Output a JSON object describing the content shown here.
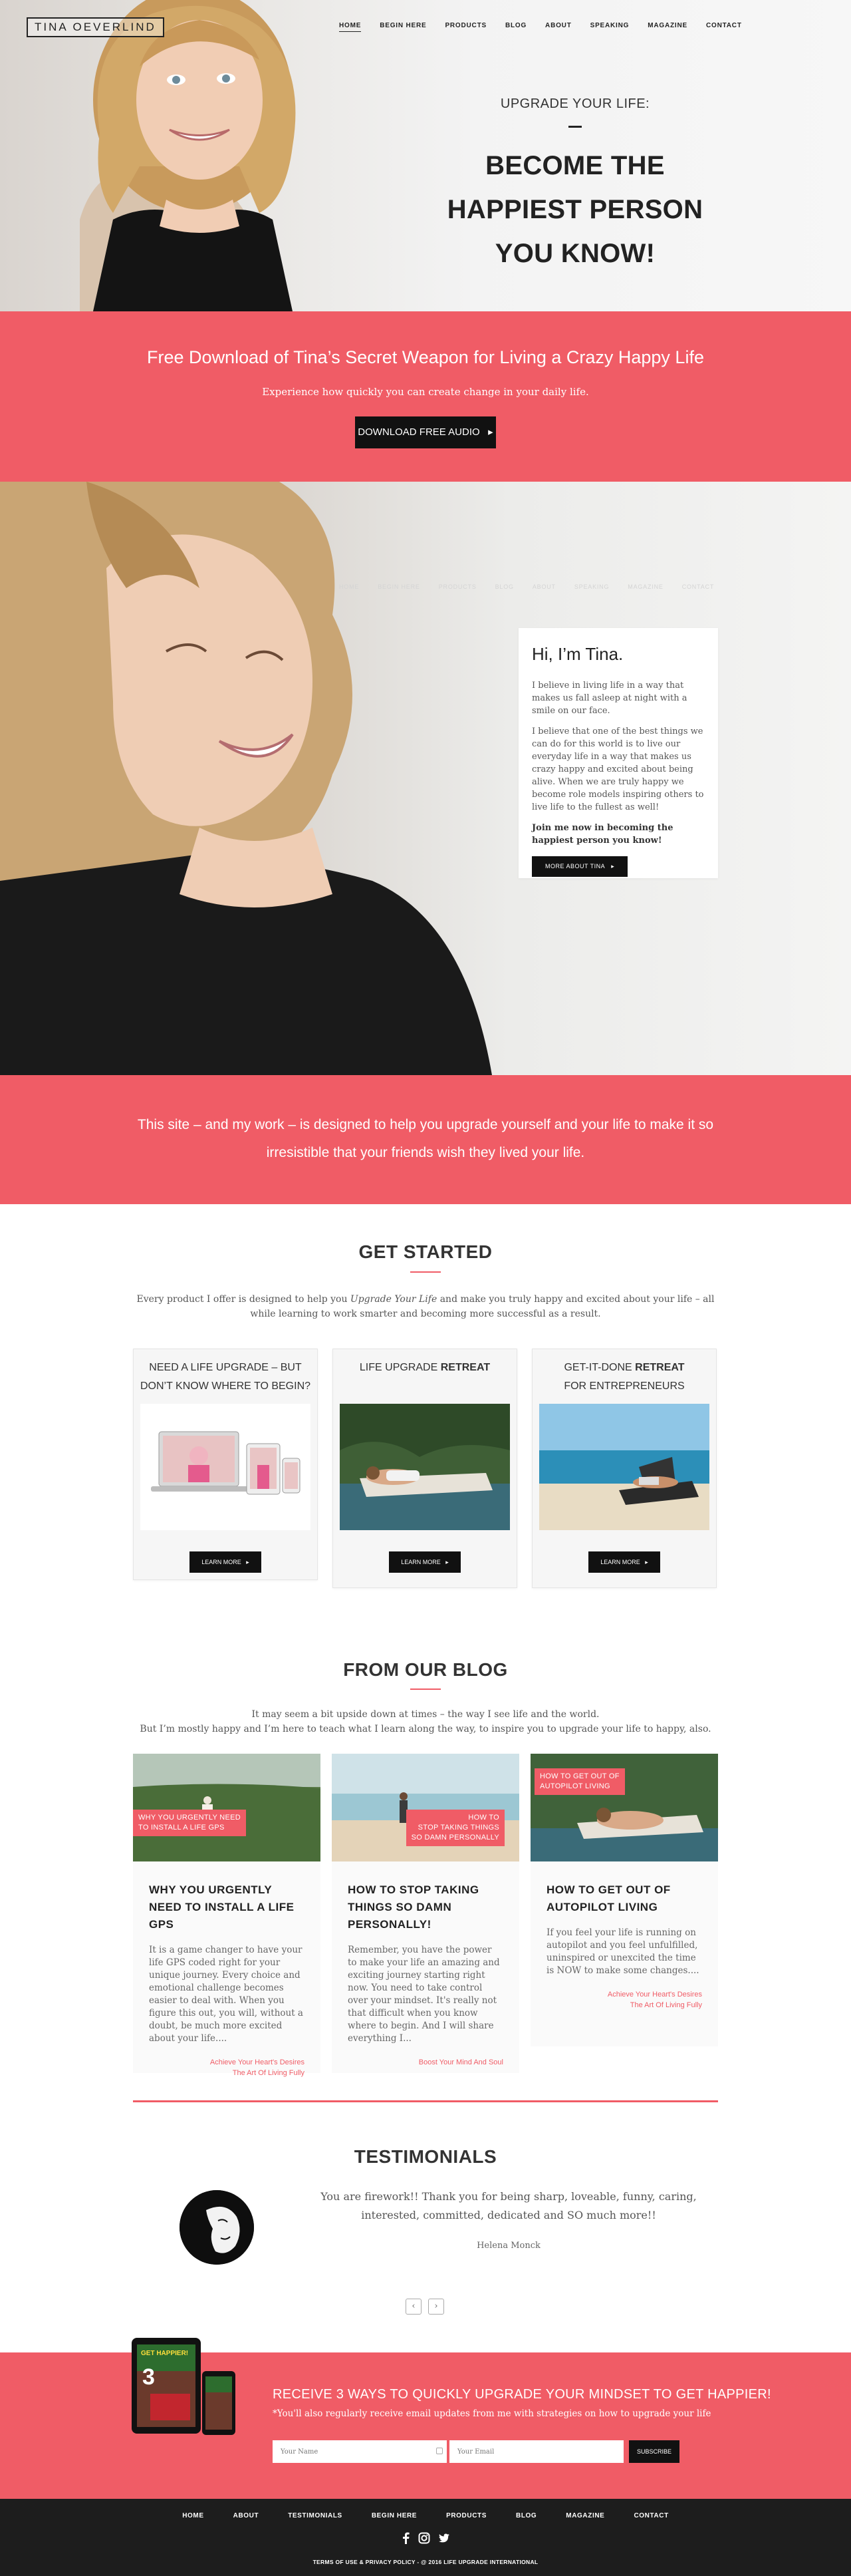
{
  "header": {
    "logo": "TINA OEVERLIND",
    "nav": [
      "HOME",
      "BEGIN HERE",
      "PRODUCTS",
      "BLOG",
      "ABOUT",
      "SPEAKING",
      "MAGAZINE",
      "CONTACT"
    ],
    "active": "HOME"
  },
  "hero": {
    "kicker": "UPGRADE YOUR LIFE:",
    "title": "BECOME THE HAPPIEST PERSON YOU KNOW!"
  },
  "download": {
    "title": "Free Download of Tina’s Secret Weapon for Living a Crazy Happy Life",
    "subtitle": "Experience how quickly you can create change in your daily life.",
    "button": "DOWNLOAD FREE AUDIO"
  },
  "about": {
    "heading": "Hi, I’m Tina.",
    "p1": "I believe in living life in a way that makes us fall asleep at night with a smile on our face.",
    "p2": "I believe that one of the best things we can do for this world is to live our everyday life in a way that makes us crazy happy and excited about being alive. When we are truly happy we become role models inspiring others to live life to the fullest as well!",
    "p3": "Join me now in becoming the happiest person you know!",
    "button": "MORE ABOUT TINA"
  },
  "mission": {
    "text": "This site – and my work – is designed to help you upgrade yourself and your life to make it so irresistible that your friends wish they lived your life."
  },
  "get_started": {
    "heading": "GET STARTED",
    "intro_a": "Every product I offer is designed to help you ",
    "intro_em": "Upgrade Your Life",
    "intro_b": " and make you truly happy and excited about your life – all while learning to work smarter and becoming more successful as a result.",
    "products": [
      {
        "title_a": "NEED A LIFE UPGRADE – BUT DON’T KNOW WHERE TO BEGIN?",
        "title_b": "",
        "title_c": "",
        "button": "LEARN MORE"
      },
      {
        "title_a": "LIFE UPGRADE ",
        "title_b": "RETREAT",
        "title_c": "",
        "button": "LEARN MORE"
      },
      {
        "title_a": "GET-IT-DONE ",
        "title_b": "RETREAT",
        "title_c": "FOR ENTREPRENEURS",
        "button": "LEARN MORE"
      }
    ]
  },
  "blog": {
    "heading": "FROM OUR BLOG",
    "intro1": "It may seem a bit upside down at times – the way I see life and the world.",
    "intro2": "But I’m mostly happy and I’m here to teach what I learn along the way, to inspire you to upgrade your life to happy, also.",
    "posts": [
      {
        "tag1": "WHY YOU URGENTLY NEED",
        "tag2": "TO INSTALL A LIFE GPS",
        "title": "WHY YOU URGENTLY NEED TO INSTALL A LIFE GPS",
        "excerpt": "It is a game changer to have your life GPS coded right for your unique journey. Every choice and emotional challenge becomes easier to deal with. When you figure this out, you will, without a doubt, be much more excited about your life....",
        "cat1": "Achieve Your Heart's Desires",
        "cat2": "The Art Of Living Fully"
      },
      {
        "tag1": "HOW TO",
        "tag2": "STOP TAKING THINGS",
        "tag3": "SO DAMN PERSONALLY",
        "title": "HOW TO STOP TAKING THINGS SO DAMN PERSONALLY!",
        "excerpt": "Remember, you have the power to make your life an amazing and exciting journey starting right now. You need to take control over your mindset. It's really not that difficult when you know where to begin. And I will share everything I...",
        "cat1": "Boost Your Mind And Soul",
        "cat2": ""
      },
      {
        "tag1": "HOW TO GET OUT OF",
        "tag2": "AUTOPILOT LIVING",
        "title": "HOW TO GET OUT OF AUTOPILOT LIVING",
        "excerpt": "If you feel your life is running on autopilot and you feel unfulfilled, uninspired or unexcited the time is NOW to make some changes....",
        "cat1": "Achieve Your Heart's Desires",
        "cat2": "The Art Of Living Fully"
      }
    ]
  },
  "testimonials": {
    "heading": "TESTIMONIALS",
    "quote": "You are firework!! Thank you for being sharp, loveable, funny, caring, interested, committed, dedicated and SO much more!!",
    "author": "Helena Monck",
    "prev": "‹",
    "next": "›"
  },
  "newsletter": {
    "title": "RECEIVE 3 WAYS TO QUICKLY UPGRADE YOUR MINDSET TO GET HAPPIER!",
    "subtitle": "*You'll also regularly receive email updates from me with strategies on how to upgrade your life",
    "name_placeholder": "Your Name",
    "email_placeholder": "Your Email",
    "button": "SUBSCRIBE",
    "book_title": "GET HAPPIER!"
  },
  "footer": {
    "nav": [
      "HOME",
      "ABOUT",
      "TESTIMONIALS",
      "BEGIN HERE",
      "PRODUCTS",
      "BLOG",
      "MAGAZINE",
      "CONTACT"
    ],
    "social": [
      "facebook-icon",
      "instagram-icon",
      "twitter-icon"
    ],
    "copyright": "TERMS OF USE & PRIVACY POLICY - @ 2016 LIFE UPGRADE INTERNATIONAL"
  },
  "colors": {
    "accent": "#f05c66",
    "dark": "#111111",
    "footer": "#1d1d1d"
  }
}
